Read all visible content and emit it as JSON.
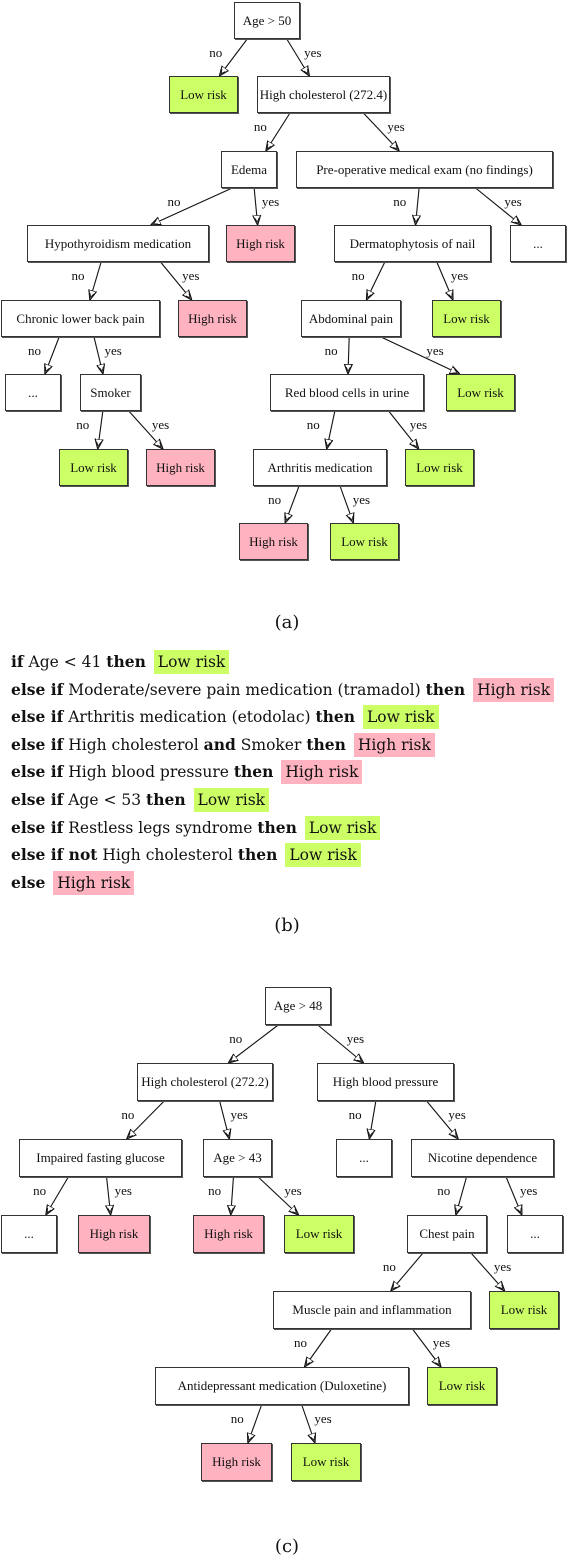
{
  "colors": {
    "low_risk": "#ccff66",
    "high_risk": "#ffb3c1",
    "internal": "#ffffff",
    "edge": "#111111"
  },
  "panel_a": {
    "caption": "(a)",
    "nodes": [
      {
        "id": "a0",
        "label": "Age > 50",
        "type": "internal"
      },
      {
        "id": "a1",
        "label": "Low risk",
        "type": "low"
      },
      {
        "id": "a2",
        "label": "High cholesterol (272.4)",
        "type": "internal"
      },
      {
        "id": "a3",
        "label": "Edema",
        "type": "internal"
      },
      {
        "id": "a4",
        "label": "Pre-operative medical exam (no findings)",
        "type": "internal"
      },
      {
        "id": "a5",
        "label": "Hypothyroidism medication",
        "type": "internal"
      },
      {
        "id": "a6",
        "label": "High risk",
        "type": "high"
      },
      {
        "id": "a7",
        "label": "Dermatophytosis of nail",
        "type": "internal"
      },
      {
        "id": "a8",
        "label": "...",
        "type": "internal"
      },
      {
        "id": "a9",
        "label": "Chronic lower back pain",
        "type": "internal"
      },
      {
        "id": "a10",
        "label": "High risk",
        "type": "high"
      },
      {
        "id": "a11",
        "label": "Abdominal pain",
        "type": "internal"
      },
      {
        "id": "a12",
        "label": "Low risk",
        "type": "low"
      },
      {
        "id": "a13",
        "label": "...",
        "type": "internal"
      },
      {
        "id": "a14",
        "label": "Smoker",
        "type": "internal"
      },
      {
        "id": "a15",
        "label": "Red blood cells in urine",
        "type": "internal"
      },
      {
        "id": "a16",
        "label": "Low risk",
        "type": "low"
      },
      {
        "id": "a17",
        "label": "Low risk",
        "type": "low"
      },
      {
        "id": "a18",
        "label": "High risk",
        "type": "high"
      },
      {
        "id": "a19",
        "label": "Arthritis medication",
        "type": "internal"
      },
      {
        "id": "a20",
        "label": "Low risk",
        "type": "low"
      },
      {
        "id": "a21",
        "label": "High risk",
        "type": "high"
      },
      {
        "id": "a22",
        "label": "Low risk",
        "type": "low"
      }
    ],
    "edges": [
      {
        "from": "a0",
        "to": "a1",
        "label": "no"
      },
      {
        "from": "a0",
        "to": "a2",
        "label": "yes"
      },
      {
        "from": "a2",
        "to": "a3",
        "label": "no"
      },
      {
        "from": "a2",
        "to": "a4",
        "label": "yes"
      },
      {
        "from": "a3",
        "to": "a5",
        "label": "no"
      },
      {
        "from": "a3",
        "to": "a6",
        "label": "yes"
      },
      {
        "from": "a4",
        "to": "a7",
        "label": "no"
      },
      {
        "from": "a4",
        "to": "a8",
        "label": "yes"
      },
      {
        "from": "a5",
        "to": "a9",
        "label": "no"
      },
      {
        "from": "a5",
        "to": "a10",
        "label": "yes"
      },
      {
        "from": "a7",
        "to": "a11",
        "label": "no"
      },
      {
        "from": "a7",
        "to": "a12",
        "label": "yes"
      },
      {
        "from": "a9",
        "to": "a13",
        "label": "no"
      },
      {
        "from": "a9",
        "to": "a14",
        "label": "yes"
      },
      {
        "from": "a11",
        "to": "a15",
        "label": "no"
      },
      {
        "from": "a11",
        "to": "a16",
        "label": "yes"
      },
      {
        "from": "a14",
        "to": "a17",
        "label": "no"
      },
      {
        "from": "a14",
        "to": "a18",
        "label": "yes"
      },
      {
        "from": "a15",
        "to": "a19",
        "label": "no"
      },
      {
        "from": "a15",
        "to": "a20",
        "label": "yes"
      },
      {
        "from": "a19",
        "to": "a21",
        "label": "no"
      },
      {
        "from": "a19",
        "to": "a22",
        "label": "yes"
      }
    ]
  },
  "panel_b": {
    "caption": "(b)",
    "rules": [
      {
        "prefix": "if",
        "condition": "Age < 41",
        "then": "then",
        "outcome": "Low risk",
        "type": "low"
      },
      {
        "prefix": "else if",
        "condition": "Moderate/severe pain medication (tramadol)",
        "then": "then",
        "outcome": "High risk",
        "type": "high"
      },
      {
        "prefix": "else if",
        "condition": "Arthritis medication (etodolac)",
        "then": "then",
        "outcome": "Low risk",
        "type": "low"
      },
      {
        "prefix": "else if",
        "condition": "High cholesterol",
        "conj": "and",
        "condition2": "Smoker",
        "then": "then",
        "outcome": "High risk",
        "type": "high"
      },
      {
        "prefix": "else if",
        "condition": "High blood pressure",
        "then": "then",
        "outcome": "High risk",
        "type": "high"
      },
      {
        "prefix": "else if",
        "condition": "Age < 53",
        "then": "then",
        "outcome": "Low risk",
        "type": "low"
      },
      {
        "prefix": "else if",
        "condition": "Restless legs syndrome",
        "then": "then",
        "outcome": "Low risk",
        "type": "low"
      },
      {
        "prefix": "else if not",
        "condition": "High cholesterol",
        "then": "then",
        "outcome": "Low risk",
        "type": "low"
      },
      {
        "prefix": "else",
        "condition": "",
        "then": "",
        "outcome": "High risk",
        "type": "high"
      }
    ]
  },
  "panel_c": {
    "caption": "(c)",
    "nodes": [
      {
        "id": "c0",
        "label": "Age > 48",
        "type": "internal"
      },
      {
        "id": "c1",
        "label": "High cholesterol (272.2)",
        "type": "internal"
      },
      {
        "id": "c2",
        "label": "High blood pressure",
        "type": "internal"
      },
      {
        "id": "c3",
        "label": "Impaired fasting glucose",
        "type": "internal"
      },
      {
        "id": "c4",
        "label": "Age > 43",
        "type": "internal"
      },
      {
        "id": "c5",
        "label": "...",
        "type": "internal"
      },
      {
        "id": "c6",
        "label": "Nicotine dependence",
        "type": "internal"
      },
      {
        "id": "c7",
        "label": "...",
        "type": "internal"
      },
      {
        "id": "c8",
        "label": "High risk",
        "type": "high"
      },
      {
        "id": "c9",
        "label": "High risk",
        "type": "high"
      },
      {
        "id": "c10",
        "label": "Low risk",
        "type": "low"
      },
      {
        "id": "c11",
        "label": "Chest pain",
        "type": "internal"
      },
      {
        "id": "c12",
        "label": "...",
        "type": "internal"
      },
      {
        "id": "c13",
        "label": "Muscle pain and inflammation",
        "type": "internal"
      },
      {
        "id": "c14",
        "label": "Low risk",
        "type": "low"
      },
      {
        "id": "c15",
        "label": "Antidepressant medication (Duloxetine)",
        "type": "internal"
      },
      {
        "id": "c16",
        "label": "Low risk",
        "type": "low"
      },
      {
        "id": "c17",
        "label": "High risk",
        "type": "high"
      },
      {
        "id": "c18",
        "label": "Low risk",
        "type": "low"
      }
    ],
    "edges": [
      {
        "from": "c0",
        "to": "c1",
        "label": "no"
      },
      {
        "from": "c0",
        "to": "c2",
        "label": "yes"
      },
      {
        "from": "c1",
        "to": "c3",
        "label": "no"
      },
      {
        "from": "c1",
        "to": "c4",
        "label": "yes"
      },
      {
        "from": "c2",
        "to": "c5",
        "label": "no"
      },
      {
        "from": "c2",
        "to": "c6",
        "label": "yes"
      },
      {
        "from": "c3",
        "to": "c7",
        "label": "no"
      },
      {
        "from": "c3",
        "to": "c8",
        "label": "yes"
      },
      {
        "from": "c4",
        "to": "c9",
        "label": "no"
      },
      {
        "from": "c4",
        "to": "c10",
        "label": "yes"
      },
      {
        "from": "c6",
        "to": "c11",
        "label": "no"
      },
      {
        "from": "c6",
        "to": "c12",
        "label": "yes"
      },
      {
        "from": "c11",
        "to": "c13",
        "label": "no"
      },
      {
        "from": "c11",
        "to": "c14",
        "label": "yes"
      },
      {
        "from": "c13",
        "to": "c15",
        "label": "no"
      },
      {
        "from": "c13",
        "to": "c16",
        "label": "yes"
      },
      {
        "from": "c15",
        "to": "c17",
        "label": "no"
      },
      {
        "from": "c15",
        "to": "c18",
        "label": "yes"
      }
    ]
  }
}
